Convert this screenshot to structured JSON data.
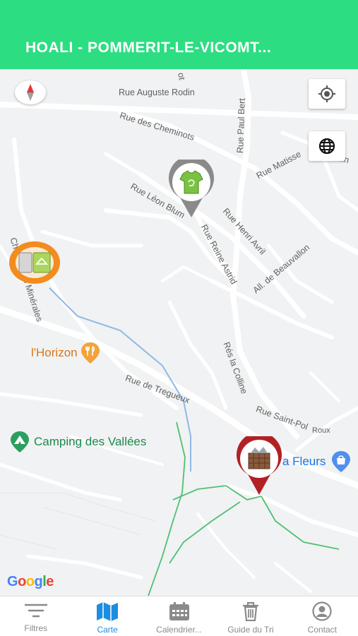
{
  "header": {
    "title": "HOALI - POMMERIT-LE-VICOMT..."
  },
  "map": {
    "streets": {
      "auguste_rodin": "Rue Auguste Rodin",
      "cheminots": "Rue des Cheminots",
      "paul_bert": "Rue Paul Bert",
      "matisse": "Rue Matisse",
      "leon_blum": "Rue Léon Blum",
      "henri_avril": "Rue Henri Avril",
      "reine_astrid": "Rue Reine Astrid",
      "beauvallon": "All. de Beauvallon",
      "minerales": "Chemin des Minérales",
      "colline": "Rés la Colline",
      "treguex": "Rue de Tregueux",
      "saint_pol": "Rue Saint-Pol",
      "roux": "Roux",
      "fragment_top": "ot",
      "fragment_right": "uin"
    },
    "pois": {
      "horizon": "l'Horizon",
      "camping": "Camping des Vallées",
      "fleurs": "a Fleurs"
    },
    "pins": [
      {
        "name": "textile",
        "icon": "tshirt-icon"
      },
      {
        "name": "recycling",
        "icon": "recycling-bins-icon"
      },
      {
        "name": "compost",
        "icon": "compost-bin-icon"
      }
    ],
    "google_logo": "Google",
    "colors": {
      "accent": "#2ddd82",
      "active_tab": "#1c8de0",
      "compost_pin": "#b22026",
      "recycle_pin": "#f28c1e",
      "textile_pin": "#8a8a8a"
    }
  },
  "tabs": [
    {
      "label": "Filtres",
      "icon": "filter-icon",
      "active": false
    },
    {
      "label": "Carte",
      "icon": "map-icon",
      "active": true
    },
    {
      "label": "Calendrier...",
      "icon": "calendar-icon",
      "active": false
    },
    {
      "label": "Guide du Tri",
      "icon": "trash-icon",
      "active": false
    },
    {
      "label": "Contact",
      "icon": "user-icon",
      "active": false
    }
  ]
}
